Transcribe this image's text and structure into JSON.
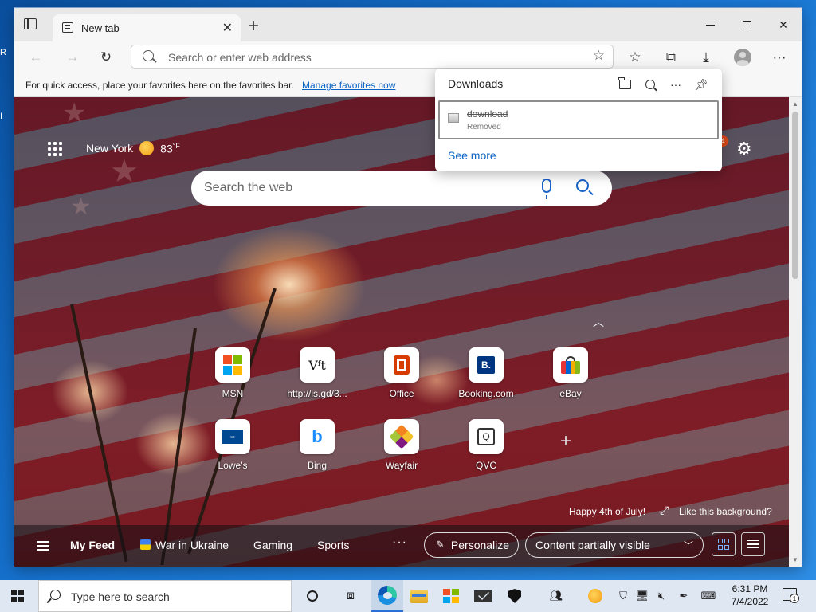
{
  "browser": {
    "tab_title": "New tab",
    "address_placeholder": "Search or enter web address",
    "favorites_bar_message": "For quick access, place your favorites here on the favorites bar.",
    "favorites_bar_link": "Manage favorites now"
  },
  "newtab": {
    "city": "New York",
    "temperature": "83",
    "temperature_unit": "°F",
    "notification_count": "4",
    "search_placeholder": "Search the web",
    "quick_links": [
      {
        "label": "MSN",
        "icon": "msn-icon"
      },
      {
        "label": "http://is.gd/3...",
        "icon": "vt-icon"
      },
      {
        "label": "Office",
        "icon": "office-icon"
      },
      {
        "label": "Booking.com",
        "icon": "booking-icon"
      },
      {
        "label": "eBay",
        "icon": "ebay-icon"
      },
      {
        "label": "Lowe's",
        "icon": "lowes-icon"
      },
      {
        "label": "Bing",
        "icon": "bing-icon"
      },
      {
        "label": "Wayfair",
        "icon": "wayfair-icon"
      },
      {
        "label": "QVC",
        "icon": "qvc-icon"
      }
    ],
    "background_caption": "Happy 4th of July!",
    "like_background": "Like this background?",
    "feed": {
      "items": [
        "My Feed",
        "War in Ukraine",
        "Gaming",
        "Sports"
      ],
      "personalize": "Personalize",
      "content_visibility": "Content partially visible"
    }
  },
  "downloads": {
    "title": "Downloads",
    "item_name": "download",
    "item_status": "Removed",
    "see_more": "See more"
  },
  "taskbar": {
    "search_placeholder": "Type here to search",
    "time": "6:31 PM",
    "date": "7/4/2022",
    "notification_count": "1"
  },
  "colors": {
    "accent": "#0b63c4",
    "taskbar": "#dfe7f2"
  }
}
